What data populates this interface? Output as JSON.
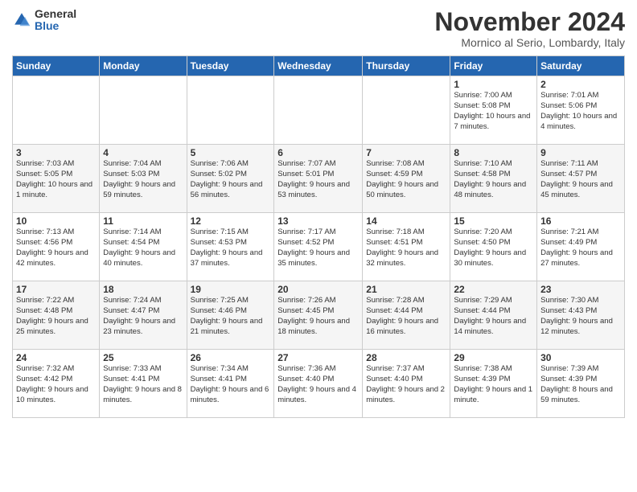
{
  "logo": {
    "general": "General",
    "blue": "Blue"
  },
  "title": "November 2024",
  "location": "Mornico al Serio, Lombardy, Italy",
  "days_of_week": [
    "Sunday",
    "Monday",
    "Tuesday",
    "Wednesday",
    "Thursday",
    "Friday",
    "Saturday"
  ],
  "weeks": [
    [
      {
        "day": "",
        "info": ""
      },
      {
        "day": "",
        "info": ""
      },
      {
        "day": "",
        "info": ""
      },
      {
        "day": "",
        "info": ""
      },
      {
        "day": "",
        "info": ""
      },
      {
        "day": "1",
        "info": "Sunrise: 7:00 AM\nSunset: 5:08 PM\nDaylight: 10 hours and 7 minutes."
      },
      {
        "day": "2",
        "info": "Sunrise: 7:01 AM\nSunset: 5:06 PM\nDaylight: 10 hours and 4 minutes."
      }
    ],
    [
      {
        "day": "3",
        "info": "Sunrise: 7:03 AM\nSunset: 5:05 PM\nDaylight: 10 hours and 1 minute."
      },
      {
        "day": "4",
        "info": "Sunrise: 7:04 AM\nSunset: 5:03 PM\nDaylight: 9 hours and 59 minutes."
      },
      {
        "day": "5",
        "info": "Sunrise: 7:06 AM\nSunset: 5:02 PM\nDaylight: 9 hours and 56 minutes."
      },
      {
        "day": "6",
        "info": "Sunrise: 7:07 AM\nSunset: 5:01 PM\nDaylight: 9 hours and 53 minutes."
      },
      {
        "day": "7",
        "info": "Sunrise: 7:08 AM\nSunset: 4:59 PM\nDaylight: 9 hours and 50 minutes."
      },
      {
        "day": "8",
        "info": "Sunrise: 7:10 AM\nSunset: 4:58 PM\nDaylight: 9 hours and 48 minutes."
      },
      {
        "day": "9",
        "info": "Sunrise: 7:11 AM\nSunset: 4:57 PM\nDaylight: 9 hours and 45 minutes."
      }
    ],
    [
      {
        "day": "10",
        "info": "Sunrise: 7:13 AM\nSunset: 4:56 PM\nDaylight: 9 hours and 42 minutes."
      },
      {
        "day": "11",
        "info": "Sunrise: 7:14 AM\nSunset: 4:54 PM\nDaylight: 9 hours and 40 minutes."
      },
      {
        "day": "12",
        "info": "Sunrise: 7:15 AM\nSunset: 4:53 PM\nDaylight: 9 hours and 37 minutes."
      },
      {
        "day": "13",
        "info": "Sunrise: 7:17 AM\nSunset: 4:52 PM\nDaylight: 9 hours and 35 minutes."
      },
      {
        "day": "14",
        "info": "Sunrise: 7:18 AM\nSunset: 4:51 PM\nDaylight: 9 hours and 32 minutes."
      },
      {
        "day": "15",
        "info": "Sunrise: 7:20 AM\nSunset: 4:50 PM\nDaylight: 9 hours and 30 minutes."
      },
      {
        "day": "16",
        "info": "Sunrise: 7:21 AM\nSunset: 4:49 PM\nDaylight: 9 hours and 27 minutes."
      }
    ],
    [
      {
        "day": "17",
        "info": "Sunrise: 7:22 AM\nSunset: 4:48 PM\nDaylight: 9 hours and 25 minutes."
      },
      {
        "day": "18",
        "info": "Sunrise: 7:24 AM\nSunset: 4:47 PM\nDaylight: 9 hours and 23 minutes."
      },
      {
        "day": "19",
        "info": "Sunrise: 7:25 AM\nSunset: 4:46 PM\nDaylight: 9 hours and 21 minutes."
      },
      {
        "day": "20",
        "info": "Sunrise: 7:26 AM\nSunset: 4:45 PM\nDaylight: 9 hours and 18 minutes."
      },
      {
        "day": "21",
        "info": "Sunrise: 7:28 AM\nSunset: 4:44 PM\nDaylight: 9 hours and 16 minutes."
      },
      {
        "day": "22",
        "info": "Sunrise: 7:29 AM\nSunset: 4:44 PM\nDaylight: 9 hours and 14 minutes."
      },
      {
        "day": "23",
        "info": "Sunrise: 7:30 AM\nSunset: 4:43 PM\nDaylight: 9 hours and 12 minutes."
      }
    ],
    [
      {
        "day": "24",
        "info": "Sunrise: 7:32 AM\nSunset: 4:42 PM\nDaylight: 9 hours and 10 minutes."
      },
      {
        "day": "25",
        "info": "Sunrise: 7:33 AM\nSunset: 4:41 PM\nDaylight: 9 hours and 8 minutes."
      },
      {
        "day": "26",
        "info": "Sunrise: 7:34 AM\nSunset: 4:41 PM\nDaylight: 9 hours and 6 minutes."
      },
      {
        "day": "27",
        "info": "Sunrise: 7:36 AM\nSunset: 4:40 PM\nDaylight: 9 hours and 4 minutes."
      },
      {
        "day": "28",
        "info": "Sunrise: 7:37 AM\nSunset: 4:40 PM\nDaylight: 9 hours and 2 minutes."
      },
      {
        "day": "29",
        "info": "Sunrise: 7:38 AM\nSunset: 4:39 PM\nDaylight: 9 hours and 1 minute."
      },
      {
        "day": "30",
        "info": "Sunrise: 7:39 AM\nSunset: 4:39 PM\nDaylight: 8 hours and 59 minutes."
      }
    ]
  ]
}
